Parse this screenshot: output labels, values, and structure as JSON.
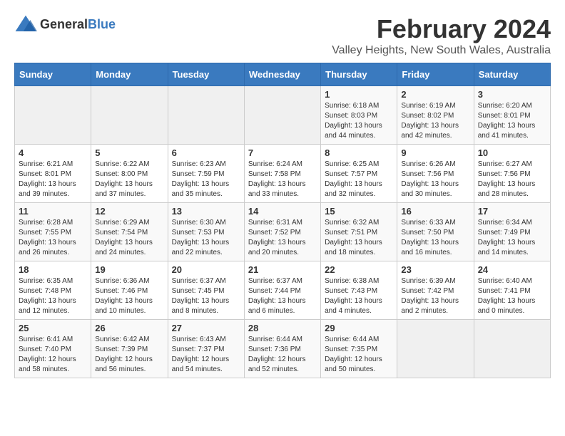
{
  "logo": {
    "general": "General",
    "blue": "Blue"
  },
  "title": "February 2024",
  "location": "Valley Heights, New South Wales, Australia",
  "weekdays": [
    "Sunday",
    "Monday",
    "Tuesday",
    "Wednesday",
    "Thursday",
    "Friday",
    "Saturday"
  ],
  "weeks": [
    [
      {
        "day": "",
        "info": ""
      },
      {
        "day": "",
        "info": ""
      },
      {
        "day": "",
        "info": ""
      },
      {
        "day": "",
        "info": ""
      },
      {
        "day": "1",
        "info": "Sunrise: 6:18 AM\nSunset: 8:03 PM\nDaylight: 13 hours and 44 minutes."
      },
      {
        "day": "2",
        "info": "Sunrise: 6:19 AM\nSunset: 8:02 PM\nDaylight: 13 hours and 42 minutes."
      },
      {
        "day": "3",
        "info": "Sunrise: 6:20 AM\nSunset: 8:01 PM\nDaylight: 13 hours and 41 minutes."
      }
    ],
    [
      {
        "day": "4",
        "info": "Sunrise: 6:21 AM\nSunset: 8:01 PM\nDaylight: 13 hours and 39 minutes."
      },
      {
        "day": "5",
        "info": "Sunrise: 6:22 AM\nSunset: 8:00 PM\nDaylight: 13 hours and 37 minutes."
      },
      {
        "day": "6",
        "info": "Sunrise: 6:23 AM\nSunset: 7:59 PM\nDaylight: 13 hours and 35 minutes."
      },
      {
        "day": "7",
        "info": "Sunrise: 6:24 AM\nSunset: 7:58 PM\nDaylight: 13 hours and 33 minutes."
      },
      {
        "day": "8",
        "info": "Sunrise: 6:25 AM\nSunset: 7:57 PM\nDaylight: 13 hours and 32 minutes."
      },
      {
        "day": "9",
        "info": "Sunrise: 6:26 AM\nSunset: 7:56 PM\nDaylight: 13 hours and 30 minutes."
      },
      {
        "day": "10",
        "info": "Sunrise: 6:27 AM\nSunset: 7:56 PM\nDaylight: 13 hours and 28 minutes."
      }
    ],
    [
      {
        "day": "11",
        "info": "Sunrise: 6:28 AM\nSunset: 7:55 PM\nDaylight: 13 hours and 26 minutes."
      },
      {
        "day": "12",
        "info": "Sunrise: 6:29 AM\nSunset: 7:54 PM\nDaylight: 13 hours and 24 minutes."
      },
      {
        "day": "13",
        "info": "Sunrise: 6:30 AM\nSunset: 7:53 PM\nDaylight: 13 hours and 22 minutes."
      },
      {
        "day": "14",
        "info": "Sunrise: 6:31 AM\nSunset: 7:52 PM\nDaylight: 13 hours and 20 minutes."
      },
      {
        "day": "15",
        "info": "Sunrise: 6:32 AM\nSunset: 7:51 PM\nDaylight: 13 hours and 18 minutes."
      },
      {
        "day": "16",
        "info": "Sunrise: 6:33 AM\nSunset: 7:50 PM\nDaylight: 13 hours and 16 minutes."
      },
      {
        "day": "17",
        "info": "Sunrise: 6:34 AM\nSunset: 7:49 PM\nDaylight: 13 hours and 14 minutes."
      }
    ],
    [
      {
        "day": "18",
        "info": "Sunrise: 6:35 AM\nSunset: 7:48 PM\nDaylight: 13 hours and 12 minutes."
      },
      {
        "day": "19",
        "info": "Sunrise: 6:36 AM\nSunset: 7:46 PM\nDaylight: 13 hours and 10 minutes."
      },
      {
        "day": "20",
        "info": "Sunrise: 6:37 AM\nSunset: 7:45 PM\nDaylight: 13 hours and 8 minutes."
      },
      {
        "day": "21",
        "info": "Sunrise: 6:37 AM\nSunset: 7:44 PM\nDaylight: 13 hours and 6 minutes."
      },
      {
        "day": "22",
        "info": "Sunrise: 6:38 AM\nSunset: 7:43 PM\nDaylight: 13 hours and 4 minutes."
      },
      {
        "day": "23",
        "info": "Sunrise: 6:39 AM\nSunset: 7:42 PM\nDaylight: 13 hours and 2 minutes."
      },
      {
        "day": "24",
        "info": "Sunrise: 6:40 AM\nSunset: 7:41 PM\nDaylight: 13 hours and 0 minutes."
      }
    ],
    [
      {
        "day": "25",
        "info": "Sunrise: 6:41 AM\nSunset: 7:40 PM\nDaylight: 12 hours and 58 minutes."
      },
      {
        "day": "26",
        "info": "Sunrise: 6:42 AM\nSunset: 7:39 PM\nDaylight: 12 hours and 56 minutes."
      },
      {
        "day": "27",
        "info": "Sunrise: 6:43 AM\nSunset: 7:37 PM\nDaylight: 12 hours and 54 minutes."
      },
      {
        "day": "28",
        "info": "Sunrise: 6:44 AM\nSunset: 7:36 PM\nDaylight: 12 hours and 52 minutes."
      },
      {
        "day": "29",
        "info": "Sunrise: 6:44 AM\nSunset: 7:35 PM\nDaylight: 12 hours and 50 minutes."
      },
      {
        "day": "",
        "info": ""
      },
      {
        "day": "",
        "info": ""
      }
    ]
  ]
}
